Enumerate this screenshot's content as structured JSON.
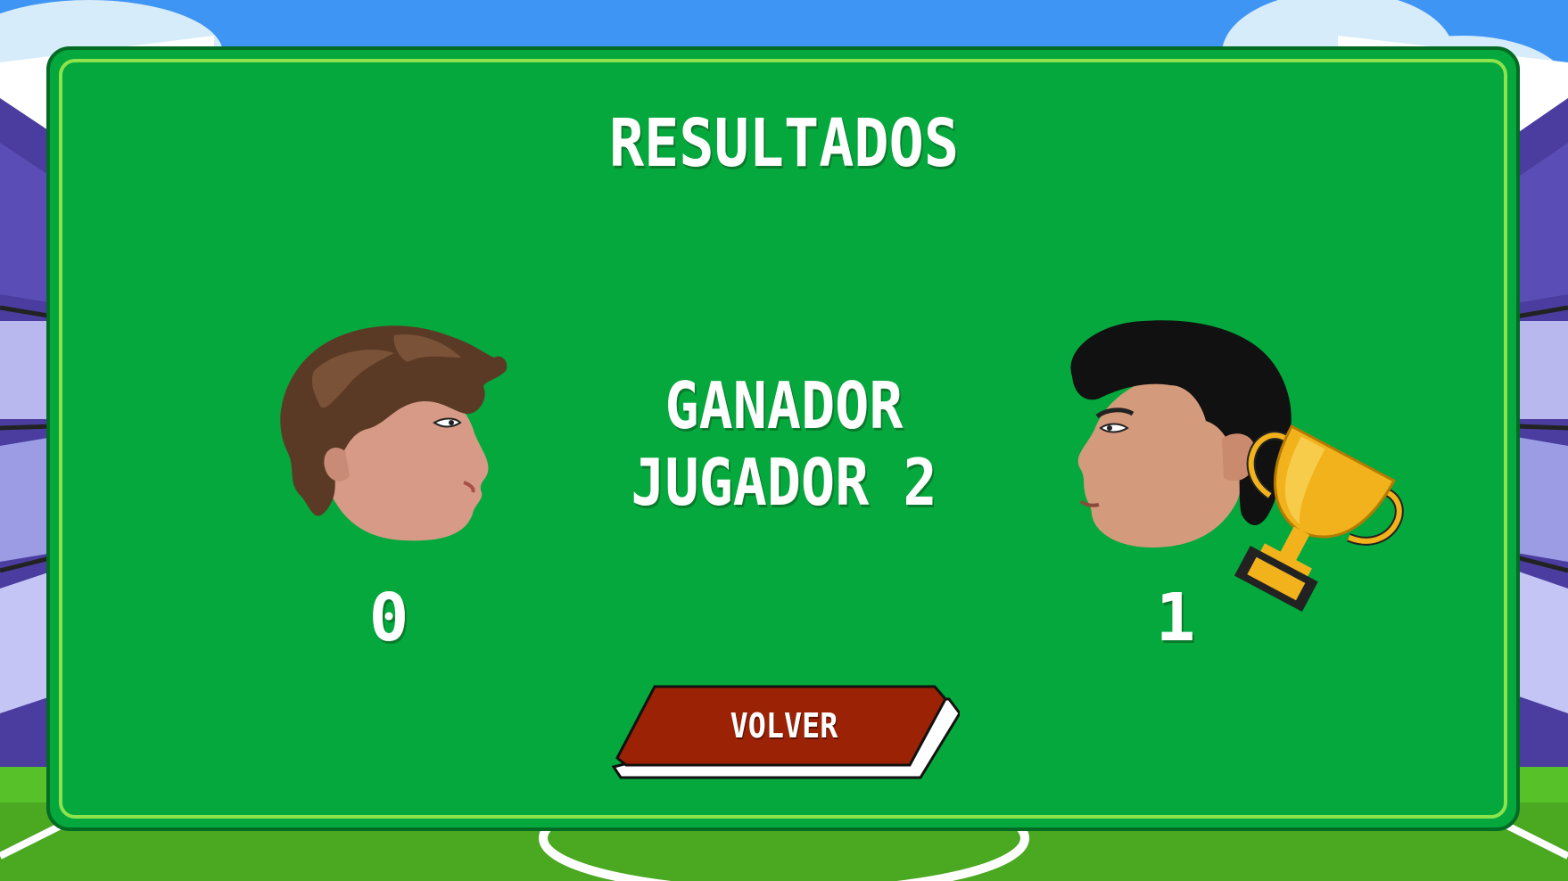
{
  "screen": {
    "title": "RESULTADOS",
    "winner_line1": "GANADOR",
    "winner_line2": "JUGADOR 2"
  },
  "players": [
    {
      "name_icon": "player-1-head-icon",
      "score": "0"
    },
    {
      "name_icon": "player-2-head-icon",
      "score": "1",
      "winner": true
    }
  ],
  "buttons": {
    "back_label": "VOLVER"
  },
  "colors": {
    "panel": "#04a83c",
    "panel_border": "#026b24",
    "panel_inner_border": "#8ce34c",
    "button": "#9b2204",
    "sky": "#3f95f4",
    "pitch": "#57c12a",
    "trophy": "#f1b21c"
  },
  "icons": [
    "trophy-icon",
    "player-1-head-icon",
    "player-2-head-icon"
  ]
}
